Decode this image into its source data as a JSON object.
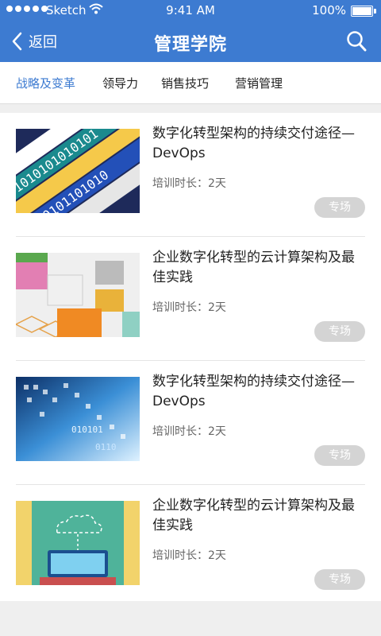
{
  "status_bar": {
    "carrier": "Sketch",
    "time": "9:41 AM",
    "battery": "100%"
  },
  "nav": {
    "back_label": "返回",
    "title": "管理学院"
  },
  "tabs": [
    {
      "label": "战略及变革",
      "active": true
    },
    {
      "label": "领导力",
      "active": false
    },
    {
      "label": "销售技巧",
      "active": false
    },
    {
      "label": "营销管理",
      "active": false
    }
  ],
  "courses": [
    {
      "title": "数字化转型架构的持续交付途径—DevOps",
      "duration": "培训时长：2天",
      "badge": "专场"
    },
    {
      "title": "企业数字化转型的云计算架构及最佳实践",
      "duration": "培训时长：2天",
      "badge": "专场"
    },
    {
      "title": "数字化转型架构的持续交付途径—DevOps",
      "duration": "培训时长：2天",
      "badge": "专场"
    },
    {
      "title": "企业数字化转型的云计算架构及最佳实践",
      "duration": "培训时长：2天",
      "badge": "专场"
    }
  ],
  "colors": {
    "primary": "#3d7bd1",
    "badge_bg": "#d4d4d4",
    "page_bg": "#efefef"
  },
  "icons": [
    "signal-dots-icon",
    "wifi-icon",
    "battery-icon",
    "back-chevron-icon",
    "search-icon"
  ]
}
